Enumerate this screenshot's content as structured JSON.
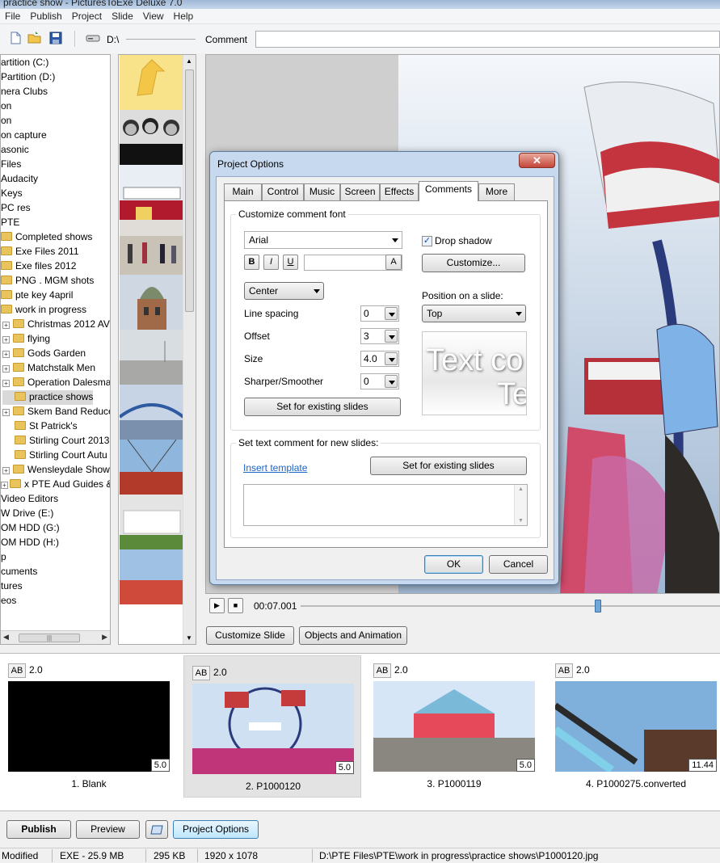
{
  "window": {
    "title": "practice show - PicturesToExe Deluxe 7.0"
  },
  "menu": [
    "File",
    "Publish",
    "Project",
    "Slide",
    "View",
    "Help"
  ],
  "toolbar": {
    "drive": "D:\\",
    "comment_label": "Comment",
    "comment_value": ""
  },
  "tree": [
    {
      "label": "artition (C:)",
      "indent": 0
    },
    {
      "label": " Partition (D:)",
      "indent": 0
    },
    {
      "label": "nera Clubs",
      "indent": 0
    },
    {
      "label": "on",
      "indent": 0
    },
    {
      "label": "on",
      "indent": 0
    },
    {
      "label": "on capture",
      "indent": 0
    },
    {
      "label": "asonic",
      "indent": 0
    },
    {
      "label": " Files",
      "indent": 0
    },
    {
      "label": "Audacity",
      "indent": 0
    },
    {
      "label": "Keys",
      "indent": 0
    },
    {
      "label": "PC res",
      "indent": 0
    },
    {
      "label": "PTE",
      "indent": 0
    },
    {
      "label": "Completed shows",
      "indent": 1,
      "folder": true
    },
    {
      "label": "Exe Files 2011",
      "indent": 1,
      "folder": true
    },
    {
      "label": "Exe files 2012",
      "indent": 1,
      "folder": true
    },
    {
      "label": "PNG . MGM shots",
      "indent": 1,
      "folder": true
    },
    {
      "label": "pte key 4april",
      "indent": 1,
      "folder": true
    },
    {
      "label": "work in progress",
      "indent": 1,
      "folder": true
    },
    {
      "label": "Christmas 2012 AV",
      "indent": 2,
      "folder": true,
      "expander": true
    },
    {
      "label": "flying",
      "indent": 2,
      "folder": true,
      "expander": true
    },
    {
      "label": "Gods Garden",
      "indent": 2,
      "folder": true,
      "expander": true
    },
    {
      "label": "Matchstalk Men",
      "indent": 2,
      "folder": true,
      "expander": true
    },
    {
      "label": "Operation Dalesma",
      "indent": 2,
      "folder": true,
      "expander": true
    },
    {
      "label": "practice shows",
      "indent": 2,
      "folder": true,
      "selected": true
    },
    {
      "label": "Skem Band Reduce",
      "indent": 2,
      "folder": true,
      "expander": true
    },
    {
      "label": "St Patrick's",
      "indent": 2,
      "folder": true
    },
    {
      "label": "Stirling Court 2013",
      "indent": 2,
      "folder": true
    },
    {
      "label": "Stirling Court Autu",
      "indent": 2,
      "folder": true
    },
    {
      "label": "Wensleydale Show",
      "indent": 2,
      "folder": true,
      "expander": true
    },
    {
      "label": "x PTE Aud Guides & Ai",
      "indent": 1,
      "folder": true,
      "expander": true
    },
    {
      "label": "Video Editors",
      "indent": 0
    },
    {
      "label": "W Drive (E:)",
      "indent": 0
    },
    {
      "label": "OM HDD (G:)",
      "indent": 0
    },
    {
      "label": "OM HDD (H:)",
      "indent": 0
    },
    {
      "label": "p",
      "indent": 0
    },
    {
      "label": "cuments",
      "indent": 0
    },
    {
      "label": "tures",
      "indent": 0
    },
    {
      "label": "eos",
      "indent": 0
    }
  ],
  "player": {
    "time": "00:07.001",
    "progress": 0.71
  },
  "buttons": {
    "customize_slide": "Customize Slide",
    "objects_animation": "Objects and Animation"
  },
  "slides": [
    {
      "name": "1. Blank",
      "ab": "AB",
      "transition": "2.0",
      "duration": "5.0",
      "selected": false
    },
    {
      "name": "2. P1000120",
      "ab": "AB",
      "transition": "2.0",
      "duration": "5.0",
      "selected": true
    },
    {
      "name": "3. P1000119",
      "ab": "AB",
      "transition": "2.0",
      "duration": "5.0",
      "selected": false
    },
    {
      "name": "4. P1000275.converted",
      "ab": "AB",
      "transition": "2.0",
      "duration": "11.44",
      "selected": false
    }
  ],
  "bottom": {
    "publish": "Publish",
    "preview": "Preview",
    "project_options": "Project Options"
  },
  "status": {
    "modified": "Modified",
    "exe": "EXE - 25.9 MB",
    "size": "295 KB",
    "dims": "1920 x 1078",
    "path": "D:\\PTE Files\\PTE\\work in progress\\practice shows\\P1000120.jpg"
  },
  "dialog": {
    "title": "Project Options",
    "close": "✕",
    "tabs": [
      "Main",
      "Control",
      "Music",
      "Screen",
      "Effects",
      "Comments",
      "More"
    ],
    "active_tab": "Comments",
    "font_group": "Customize comment font",
    "font": "Arial",
    "bold": "B",
    "italic": "I",
    "underline": "U",
    "color_btn": "A",
    "drop_shadow": "Drop shadow",
    "customize": "Customize...",
    "align": "Center",
    "position_label": "Position on a slide:",
    "position": "Top",
    "line_spacing_label": "Line spacing",
    "line_spacing": "0",
    "offset_label": "Offset",
    "offset": "3",
    "size_label": "Size",
    "size": "4.0",
    "sharper_label": "Sharper/Smoother",
    "sharper": "0",
    "set_existing_1": "Set for existing slides",
    "sample_text_1": "Text co",
    "sample_text_2": "Te",
    "text_group": "Set text comment for new slides:",
    "insert_template": "Insert template",
    "set_existing_2": "Set for existing slides",
    "comment_text": "",
    "ok": "OK",
    "cancel": "Cancel"
  }
}
